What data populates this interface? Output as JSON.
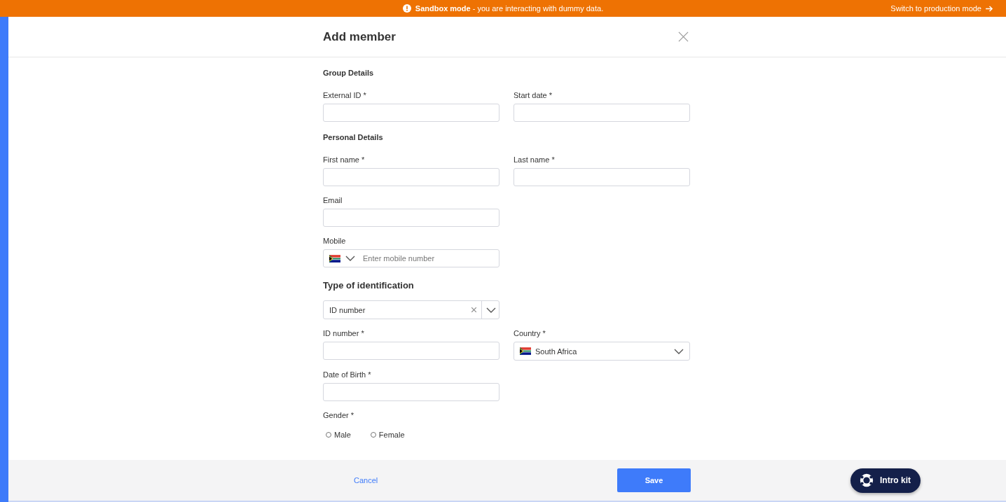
{
  "banner": {
    "title": "Sandbox mode",
    "message": " - you are interacting with dummy data.",
    "action": "Switch to production mode"
  },
  "dialog": {
    "title": "Add member"
  },
  "sections": [
    {
      "heading": "Group Details",
      "kind": "minor",
      "rows": [
        [
          {
            "kind": "text",
            "label": "External ID *"
          },
          {
            "kind": "text",
            "label": "Start date *"
          }
        ]
      ]
    },
    {
      "heading": "Personal Details",
      "kind": "minor",
      "rows": [
        [
          {
            "kind": "text",
            "label": "First name *"
          },
          {
            "kind": "text",
            "label": "Last name *"
          }
        ],
        [
          {
            "kind": "text",
            "label": "Email"
          }
        ],
        [
          {
            "kind": "phone",
            "label": "Mobile",
            "placeholder": "Enter mobile number"
          }
        ]
      ]
    },
    {
      "heading": "Type of identification",
      "kind": "major",
      "rows": [
        [
          {
            "kind": "select",
            "value": "ID number"
          }
        ],
        [
          {
            "kind": "text",
            "label": "ID number *"
          },
          {
            "kind": "country",
            "label": "Country *",
            "value": "South Africa"
          }
        ],
        [
          {
            "kind": "text",
            "label": "Date of Birth *"
          }
        ],
        [
          {
            "kind": "radio",
            "label": "Gender *",
            "options": [
              {
                "label": "Male",
                "selected": false
              },
              {
                "label": "Female",
                "selected": false
              }
            ]
          }
        ]
      ]
    }
  ],
  "footer": {
    "cancel": "Cancel",
    "save": "Save",
    "help": "Intro kit"
  }
}
